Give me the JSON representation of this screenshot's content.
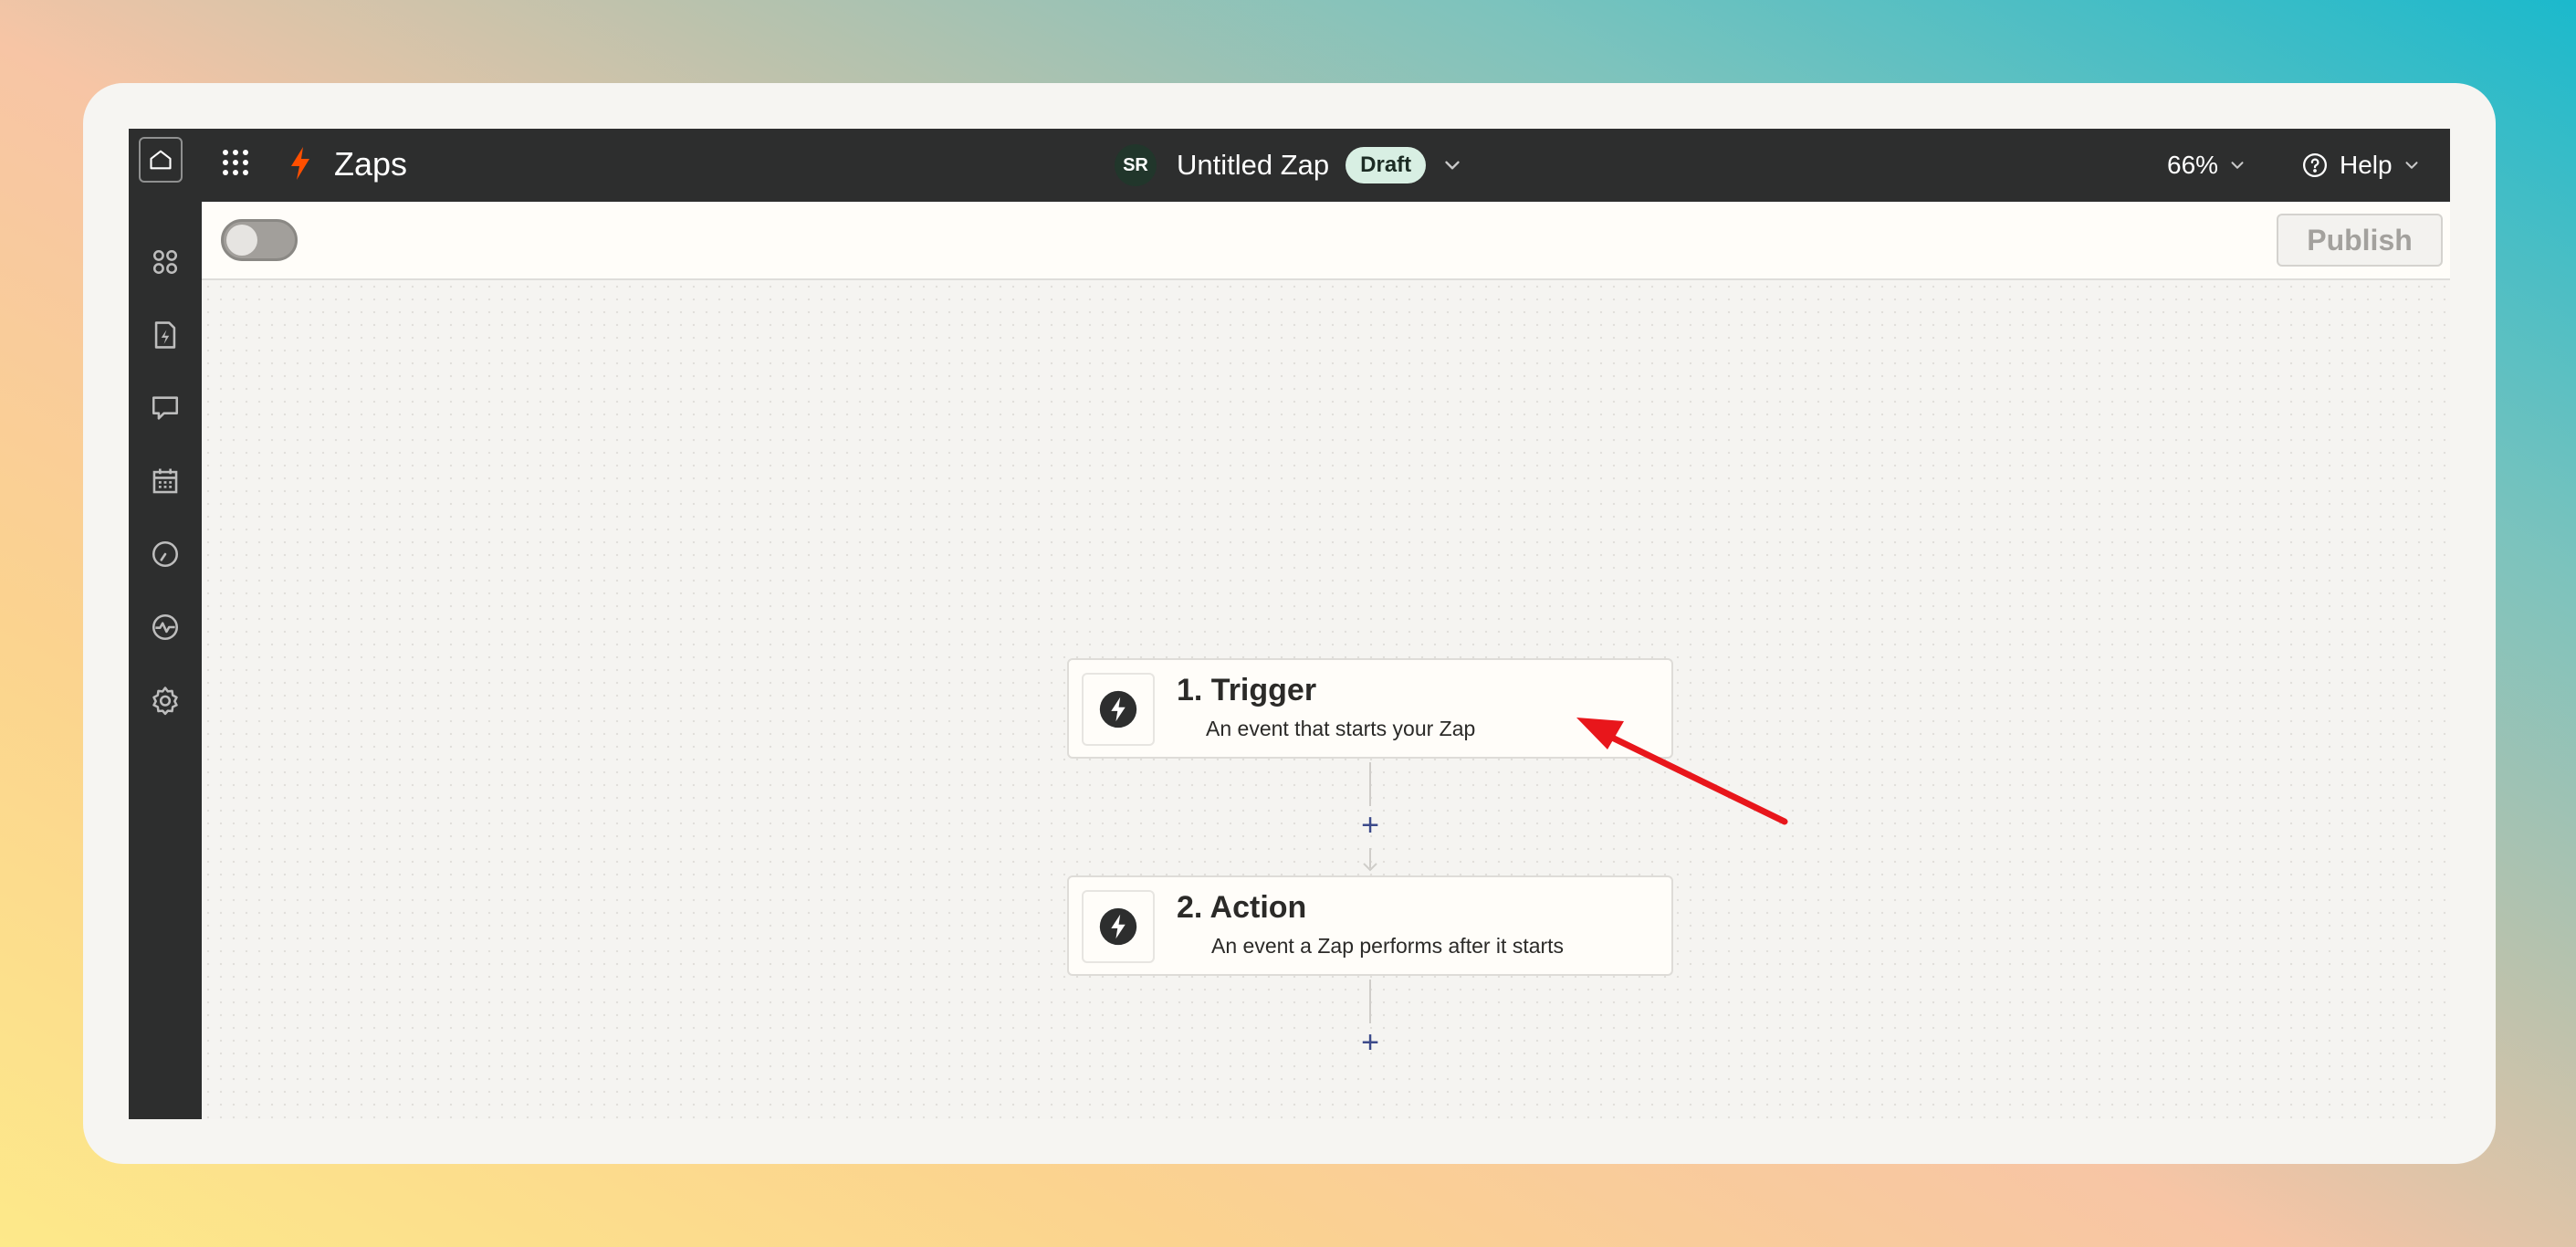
{
  "topbar": {
    "app_title": "Zaps",
    "avatar_initials": "SR",
    "zap_name": "Untitled Zap",
    "status_badge": "Draft",
    "zoom_level": "66%",
    "help_label": "Help"
  },
  "subbar": {
    "publish_label": "Publish",
    "toggle_on": false
  },
  "canvas": {
    "steps": [
      {
        "title": "1. Trigger",
        "description": "An event that starts your Zap",
        "icon": "bolt-icon"
      },
      {
        "title": "2. Action",
        "description": "An event a Zap performs after it starts",
        "icon": "bolt-icon"
      }
    ],
    "add_step_symbol": "+"
  },
  "sidebar": {
    "items": [
      {
        "icon": "apps-cluster-icon"
      },
      {
        "icon": "zap-file-icon"
      },
      {
        "icon": "chat-icon"
      },
      {
        "icon": "calendar-icon"
      },
      {
        "icon": "history-clock-icon"
      },
      {
        "icon": "activity-icon"
      },
      {
        "icon": "settings-gear-icon"
      }
    ]
  },
  "colors": {
    "topbar_bg": "#2d2e2e",
    "brand_orange": "#ff4f00",
    "annotation_arrow": "#e8161b",
    "draft_badge_bg": "#d8efe3"
  }
}
